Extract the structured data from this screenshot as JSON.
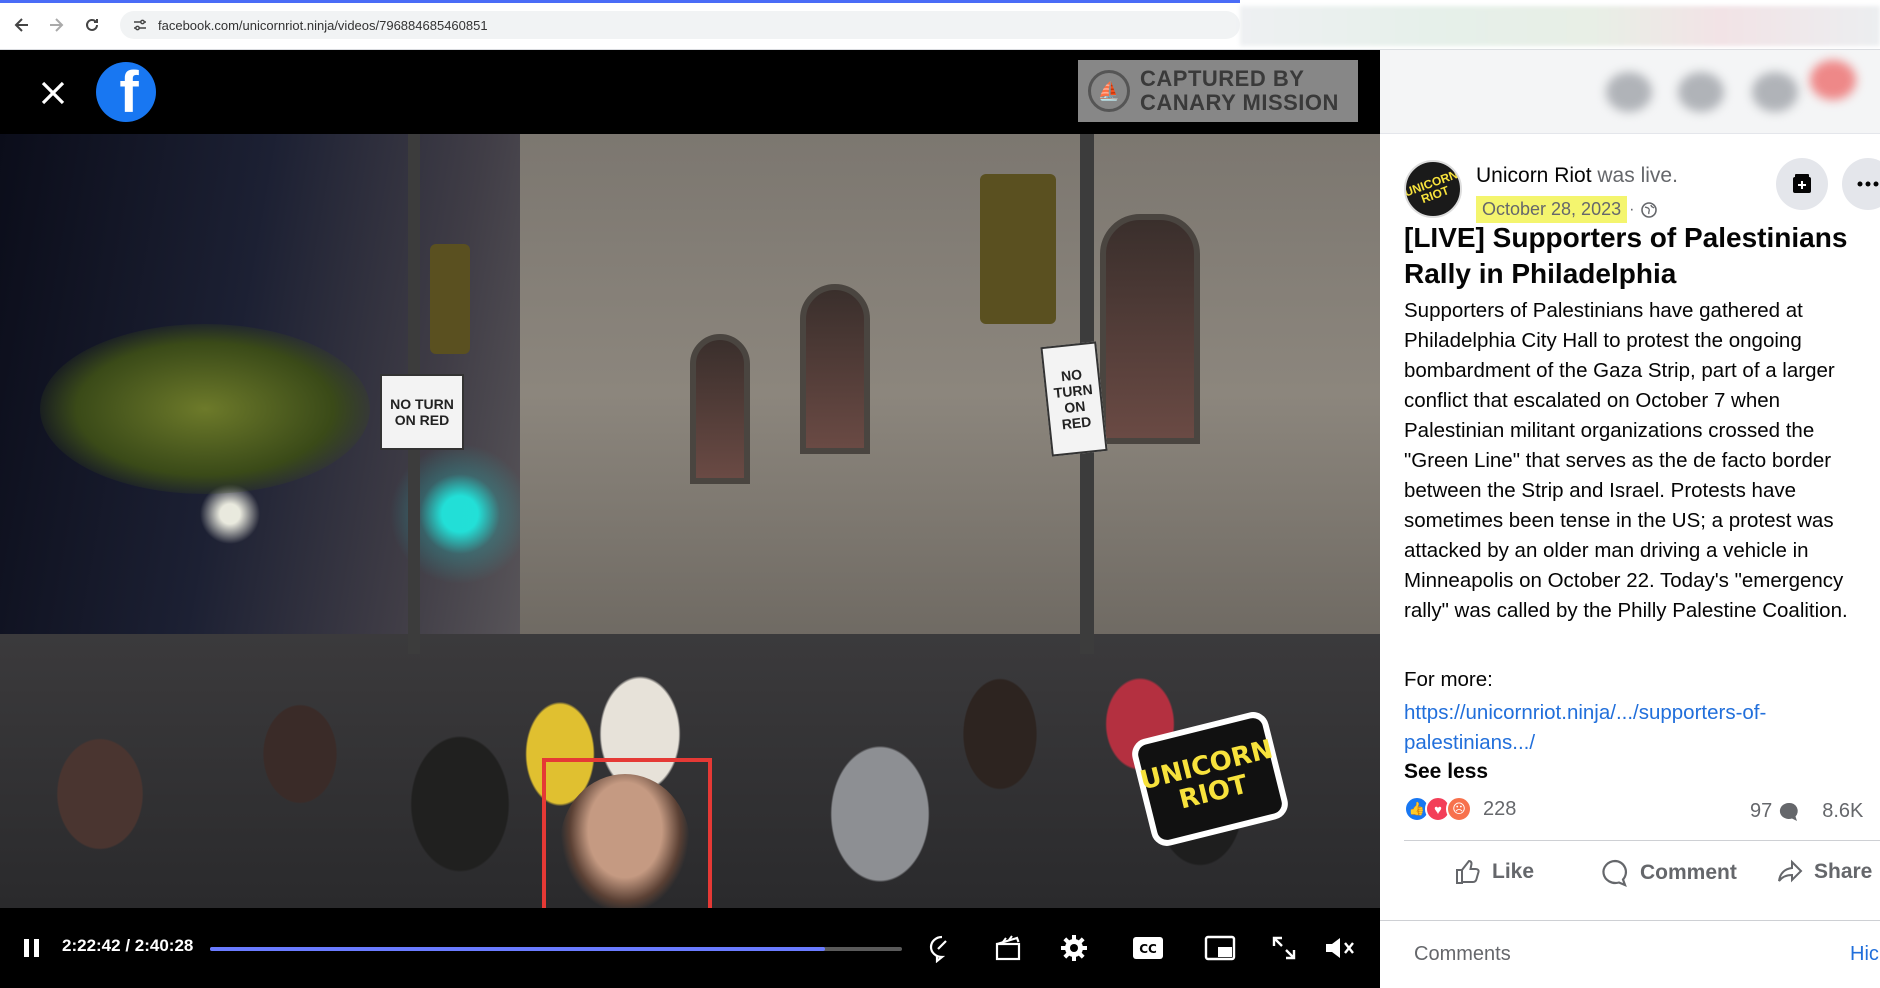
{
  "browser": {
    "url": "facebook.com/unicornriot.ninja/videos/796884685460851"
  },
  "watermark": {
    "line1": "CAPTURED BY",
    "line2": "CANARY MISSION"
  },
  "video": {
    "sticker_line1": "UNICORN",
    "sticker_line2": "RIOT",
    "sign_left": "NO TURN ON RED",
    "sign_right": "NO TURN ON RED",
    "current_time": "2:22:42",
    "duration": "2:40:28",
    "time_display": "2:22:42 / 2:40:28",
    "progress_fraction": 0.889
  },
  "post": {
    "author": "Unicorn Riot",
    "author_suffix": "was live.",
    "date": "October 28, 2023",
    "avatar_text": "UNICORN RIOT",
    "title": "[LIVE] Supporters of Palestinians Rally in Philadelphia",
    "body": "Supporters of Palestinians have gathered at Philadelphia City Hall to protest the ongoing bombardment of the Gaza Strip, part of a larger conflict that escalated on October 7 when Palestinian militant organizations crossed the \"Green Line\" that serves as the de facto border between the Strip and Israel. Protests have sometimes been tense in the US; a protest was attacked by an older man driving a vehicle in Minneapolis on October 22. Today's \"emergency rally\" was called by the Philly Palestine Coalition.",
    "for_more": "For more:",
    "link": "https://unicornriot.ninja/.../supporters-of-palestinians.../",
    "see_less": "See less",
    "reaction_count": "228",
    "comment_count": "97",
    "share_count": "8.6K",
    "like_label": "Like",
    "comment_label": "Comment",
    "share_label": "Share",
    "comments_heading": "Comments",
    "hide_label": "Hic"
  },
  "colors": {
    "facebook_blue": "#1877f2",
    "link": "#216fdb",
    "date_highlight": "#f4f56e",
    "progress": "#6a7bff",
    "highlight_box": "#e53935"
  }
}
